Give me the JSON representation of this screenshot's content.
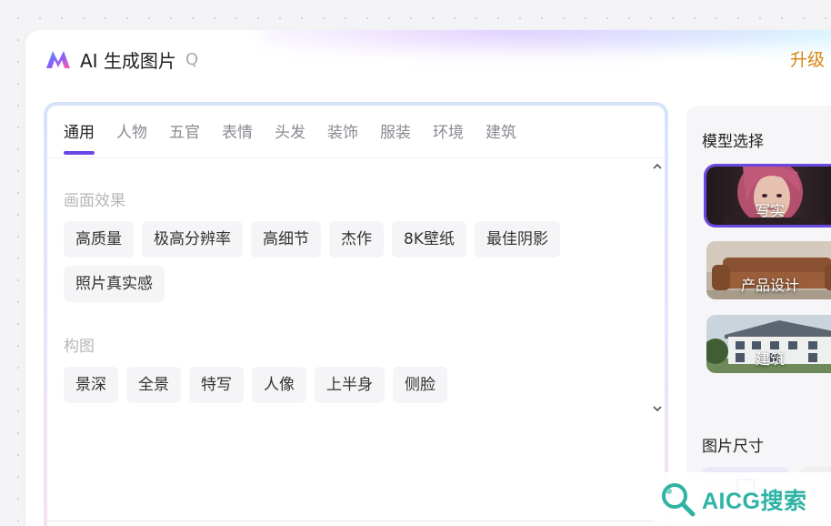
{
  "header": {
    "app_title": "AI 生成图片",
    "search_glyph": "Q",
    "upgrade_label": "升级"
  },
  "tabs": [
    {
      "label": "通用",
      "active": true
    },
    {
      "label": "人物",
      "active": false
    },
    {
      "label": "五官",
      "active": false
    },
    {
      "label": "表情",
      "active": false
    },
    {
      "label": "头发",
      "active": false
    },
    {
      "label": "装饰",
      "active": false
    },
    {
      "label": "服装",
      "active": false
    },
    {
      "label": "环境",
      "active": false
    },
    {
      "label": "建筑",
      "active": false
    }
  ],
  "sections": [
    {
      "title": "画面效果",
      "tags": [
        "高质量",
        "极高分辨率",
        "高细节",
        "杰作",
        "8K壁纸",
        "最佳阴影",
        "照片真实感"
      ]
    },
    {
      "title": "构图",
      "tags": [
        "景深",
        "全景",
        "特写",
        "人像",
        "上半身",
        "侧脸"
      ]
    }
  ],
  "right_panel": {
    "model_title": "模型选择",
    "models": [
      {
        "label": "写实",
        "selected": true
      },
      {
        "label": "产品设计",
        "selected": false
      },
      {
        "label": "建筑",
        "selected": false
      }
    ],
    "size_title": "图片尺寸"
  },
  "watermark": {
    "text": "AICG搜索"
  },
  "colors": {
    "accent": "#6b47e6",
    "upgrade": "#d9840f",
    "watermark": "#2fb3a4"
  },
  "icons": [
    "app-logo-icon",
    "search-icon",
    "scroll-up-icon",
    "scroll-down-icon",
    "portrait-size-icon",
    "magnifier-logo-icon"
  ]
}
